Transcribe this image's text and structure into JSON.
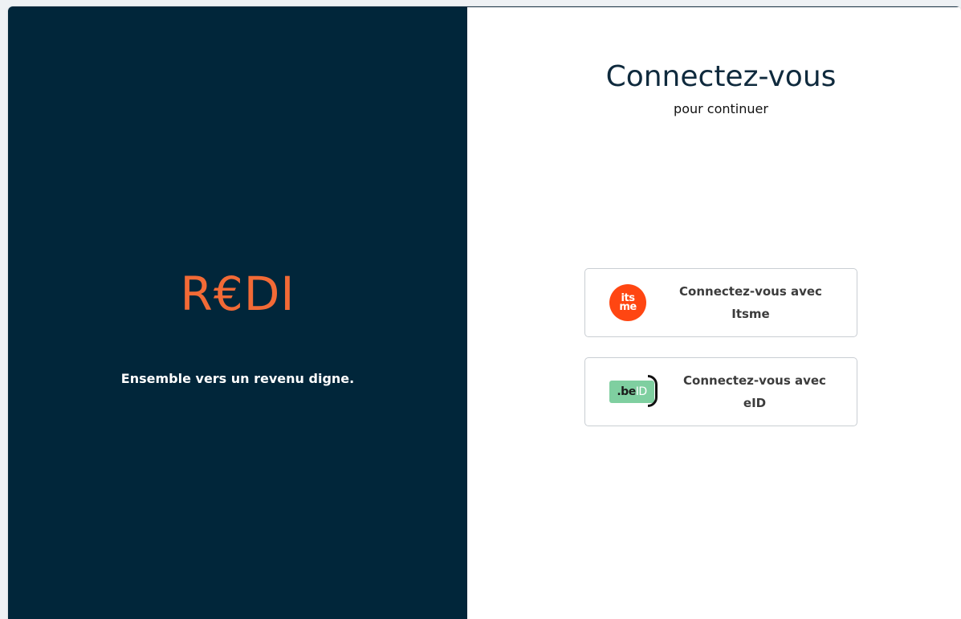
{
  "left": {
    "logo_text": "R€DI",
    "tagline": "Ensemble vers un revenu digne."
  },
  "right": {
    "title": "Connectez-vous",
    "subtitle": "pour continuer",
    "buttons": [
      {
        "line1": "Connectez-vous avec",
        "line2": "Itsme",
        "icon": "itsme-icon",
        "icon_text_top": "its",
        "icon_text_bottom": "me"
      },
      {
        "line1": "Connectez-vous avec",
        "line2": "eID",
        "icon": "beid-icon",
        "icon_text_be": ".be",
        "icon_text_id": "ID"
      }
    ]
  },
  "colors": {
    "panel_dark": "#01263a",
    "brand_orange": "#f26a36",
    "itsme_orange": "#ff4612",
    "beid_green": "#7fcfa0"
  }
}
